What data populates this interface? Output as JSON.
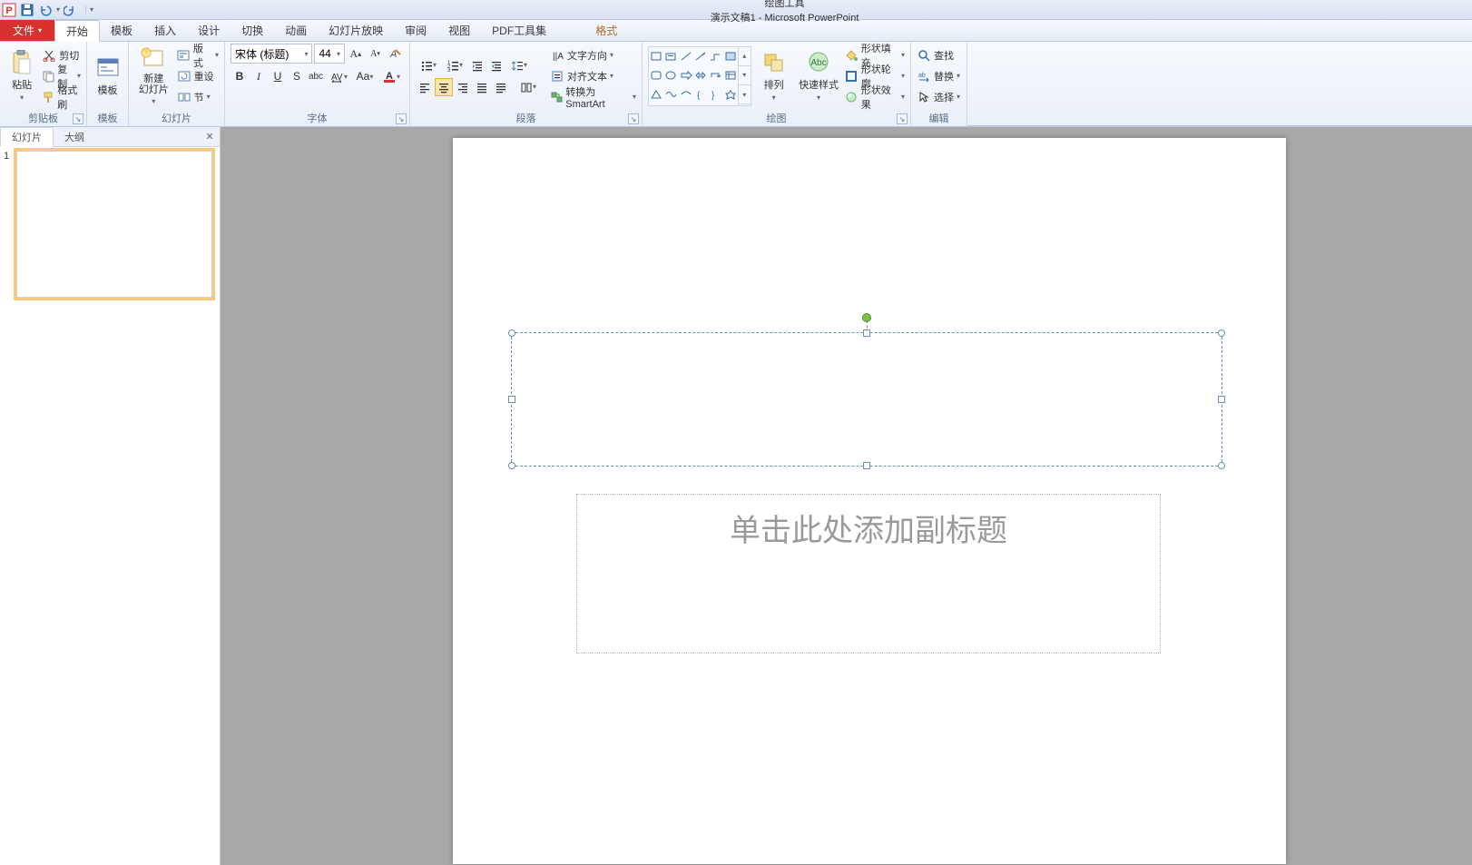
{
  "app": {
    "title_center": "演示文稿1 - Microsoft PowerPoint",
    "contextual_label": "绘图工具"
  },
  "qat": {
    "items": [
      "powerpoint-icon",
      "save-icon",
      "undo-icon",
      "redo-icon",
      "qat-more"
    ]
  },
  "tabs": {
    "file": "文件",
    "list": [
      "开始",
      "模板",
      "插入",
      "设计",
      "切换",
      "动画",
      "幻灯片放映",
      "审阅",
      "视图",
      "PDF工具集"
    ],
    "contextual": "格式",
    "active_index": 0
  },
  "ribbon": {
    "clipboard": {
      "label": "剪贴板",
      "paste": "粘贴",
      "cut": "剪切",
      "copy": "复制",
      "format_painter": "格式刷"
    },
    "template": {
      "label": "模板",
      "btn": "模板"
    },
    "slides": {
      "label": "幻灯片",
      "new_slide": "新建\n幻灯片",
      "layout": "版式",
      "reset": "重设",
      "section": "节"
    },
    "font": {
      "label": "字体",
      "name": "宋体 (标题)",
      "size": "44",
      "bold": "B",
      "italic": "I",
      "underline": "U",
      "strike": "S",
      "abc": "abc",
      "Aa": "Aa"
    },
    "para": {
      "label": "段落",
      "text_dir": "文字方向",
      "align_text": "对齐文本",
      "smartart": "转换为 SmartArt"
    },
    "drawing": {
      "label": "绘图",
      "arrange": "排列",
      "quick_styles": "快速样式",
      "shape_fill": "形状填充",
      "shape_outline": "形状轮廓",
      "shape_effects": "形状效果"
    },
    "editing": {
      "label": "编辑",
      "find": "查找",
      "replace": "替换",
      "select": "选择"
    }
  },
  "thumbs": {
    "tab_slides": "幻灯片",
    "tab_outline": "大纲",
    "items": [
      {
        "num": "1"
      }
    ]
  },
  "slide": {
    "subtitle_placeholder": "单击此处添加副标题"
  }
}
